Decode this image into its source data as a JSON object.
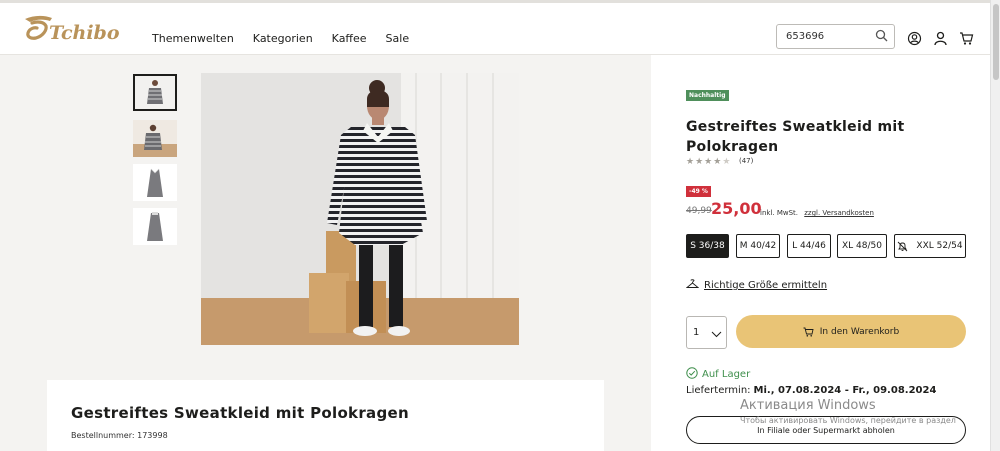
{
  "header": {
    "nav": [
      "Themenwelten",
      "Kategorien",
      "Kaffee",
      "Sale"
    ],
    "search": {
      "value": "653696"
    },
    "icons": [
      "search-icon",
      "account-icon",
      "user-icon",
      "cart-icon"
    ]
  },
  "gallery": {
    "thumbnails": [
      "front view model",
      "detail view model",
      "dress front",
      "dress back"
    ],
    "active_index": 0
  },
  "product": {
    "badge": "Nachhaltig",
    "title": "Gestreiftes Sweatkleid mit Polokragen",
    "rating": {
      "stars": 4,
      "max": 5,
      "count": "(47)"
    },
    "discount": "-49 %",
    "old_price": "49,99",
    "price": "25,00",
    "tax_note": "inkl. MwSt.",
    "shipping_link": "zzgl. Versandkosten",
    "sizes": [
      {
        "label": "S 36/38",
        "selected": true,
        "bell": false
      },
      {
        "label": "M 40/42",
        "selected": false,
        "bell": false
      },
      {
        "label": "L 44/46",
        "selected": false,
        "bell": false
      },
      {
        "label": "XL 48/50",
        "selected": false,
        "bell": false
      },
      {
        "label": "XXL 52/54",
        "selected": false,
        "bell": true
      }
    ],
    "size_finder": "Richtige Größe ermitteln",
    "quantity": "1",
    "add_to_cart": "In den Warenkorb",
    "stock": "Auf Lager",
    "delivery_label": "Liefertermin:",
    "delivery_dates": "Mi., 07.08.2024 - Fr., 09.08.2024",
    "store_pickup": "In Filiale oder Supermarkt abholen"
  },
  "description": {
    "title": "Gestreiftes Sweatkleid mit Polokragen",
    "order_number": "Bestellnummer: 173998"
  },
  "watermark": {
    "line1": "Активация Windows",
    "line2": "Чтобы активировать Windows, перейдите в раздел"
  },
  "colors": {
    "accent": "#e9c476",
    "sale": "#d0303b",
    "sustainable": "#4f8f5b",
    "in_stock": "#3f8f4c"
  }
}
